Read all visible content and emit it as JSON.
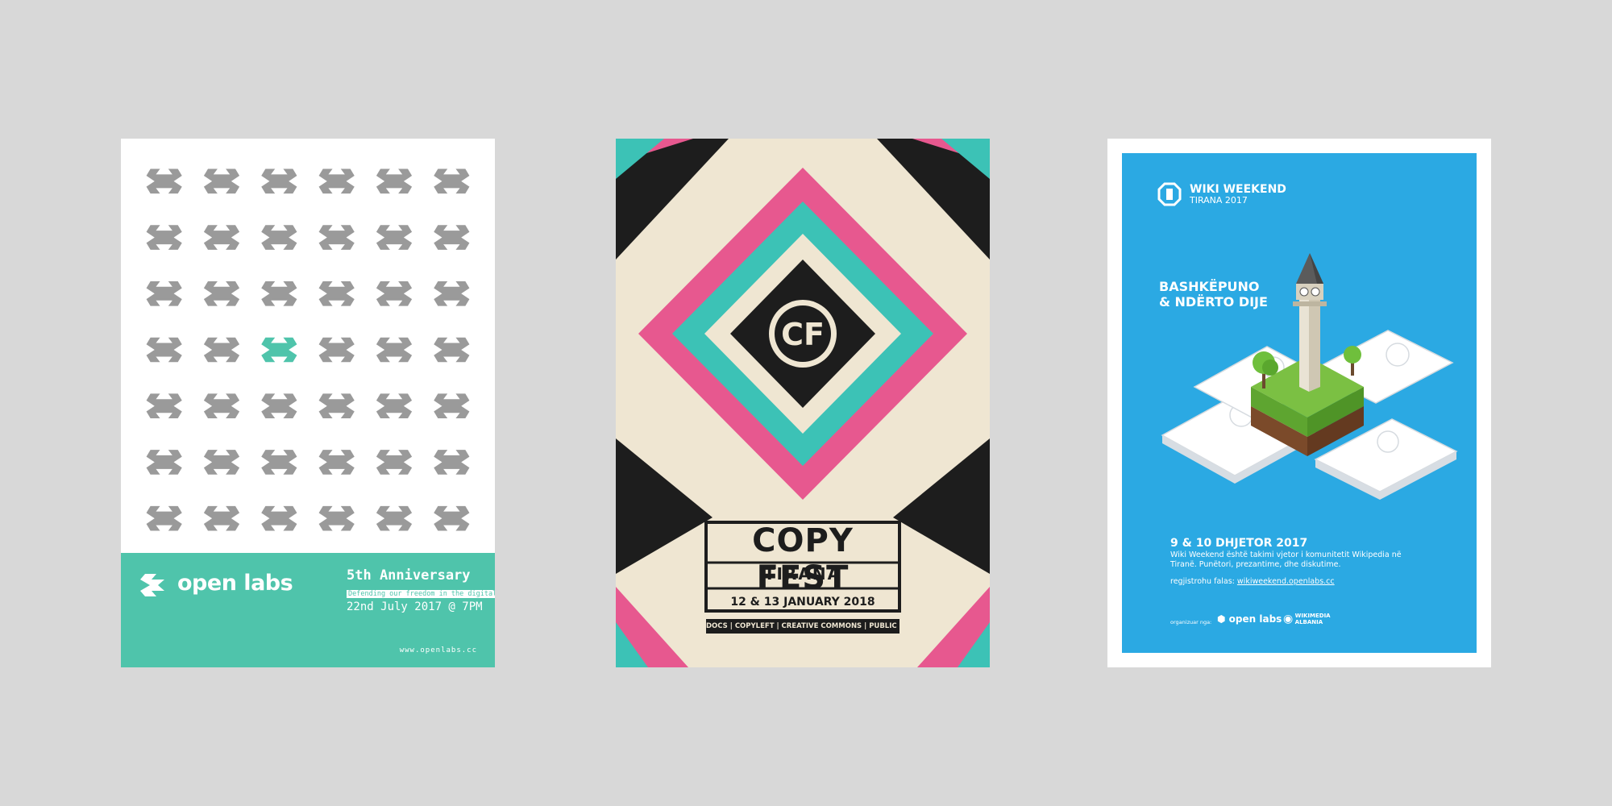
{
  "openlabs": {
    "logo_text": "open labs",
    "anniv_title": "5th Anniversary",
    "anniv_tagline": "Defending our freedom in the digital age",
    "anniv_date": "22nd July 2017 @ 7PM",
    "url": "www.openlabs.cc",
    "colors": {
      "accent": "#4fc4ab",
      "pattern": "#9a9a9a"
    },
    "pattern": {
      "rows": 7,
      "cols": 6,
      "highlight_row": 3,
      "highlight_col": 2
    }
  },
  "copyfest": {
    "title": "COPY FEST",
    "city": "TIRANA",
    "date": "12 & 13 JANUARY 2018",
    "topics": "DOCS | COPYLEFT | CREATIVE COMMONS | PUBLIC DOMAIN",
    "logo_text": "CF",
    "colors": {
      "pink": "#e7588f",
      "teal": "#3cc2b6",
      "black": "#1d1d1d",
      "cream": "#efe6d2"
    }
  },
  "wiki": {
    "title": "WIKI WEEKEND",
    "subtitle": "TIRANA 2017",
    "headline_1": "BASHKËPUNO",
    "headline_2": "& NDËRTO DIJE",
    "date": "9 & 10 DHJETOR 2017",
    "description": "Wiki Weekend është takimi vjetor i komunitetit Wikipedia në Tiranë. Punëtori, prezantime, dhe diskutime.",
    "register_label": "regjistrohu falas:",
    "register_link": "wikiweekend.openlabs.cc",
    "org_label": "organizuar nga:",
    "org_openlabs": "open labs",
    "org_wikimedia": "WIKIMEDIA",
    "org_wikimedia_sub": "ALBANIA",
    "colors": {
      "bg": "#2ba9e3"
    }
  }
}
